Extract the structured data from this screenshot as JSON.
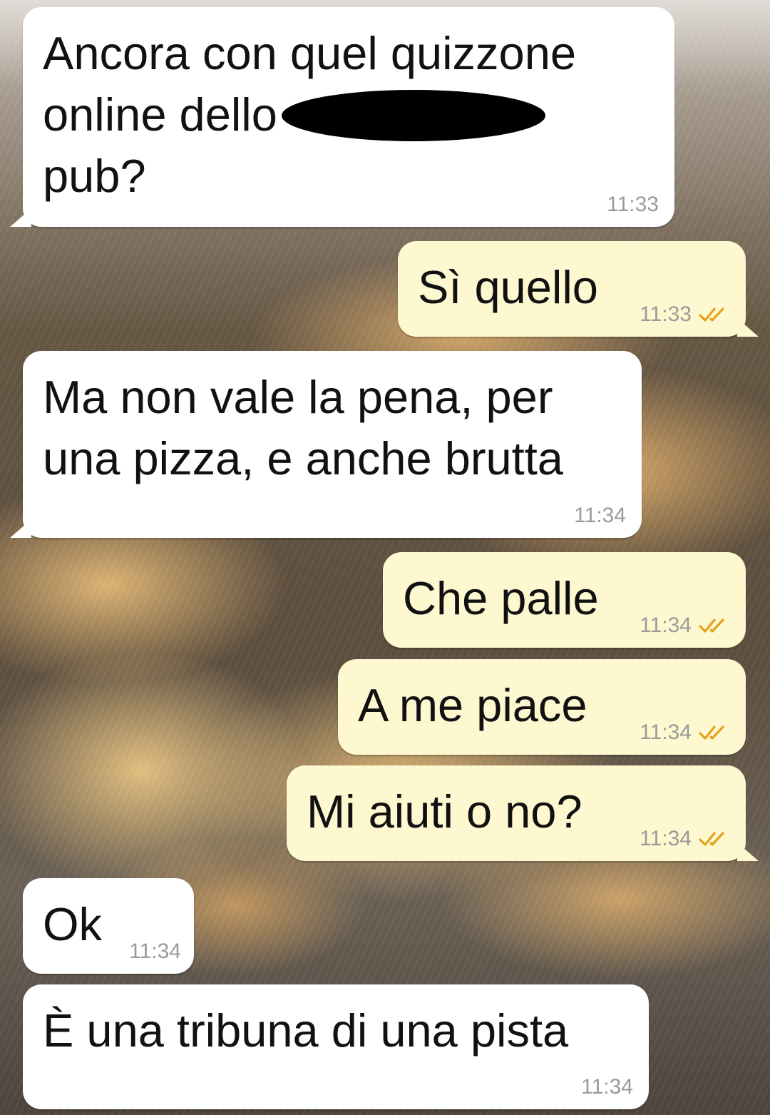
{
  "colors": {
    "incoming_bubble": "#ffffff",
    "outgoing_bubble": "#fdf8d0",
    "read_ticks": "#e3a21a",
    "timestamp": "#9a9a9a"
  },
  "messages": [
    {
      "direction": "in",
      "line1": "Ancora con quel quizzone",
      "line2": "online dello",
      "line3": "pub?",
      "time": "11:33",
      "redacted_icon": "redaction-mark"
    },
    {
      "direction": "out",
      "text": "Sì quello",
      "time": "11:33",
      "status_icon": "double-check-icon"
    },
    {
      "direction": "in",
      "text": "Ma non vale la pena, per\nuna pizza, e anche brutta",
      "time": "11:34"
    },
    {
      "direction": "out",
      "text": "Che palle",
      "time": "11:34",
      "status_icon": "double-check-icon"
    },
    {
      "direction": "out",
      "text": "A me piace",
      "time": "11:34",
      "status_icon": "double-check-icon"
    },
    {
      "direction": "out",
      "text": "Mi aiuti o no?",
      "time": "11:34",
      "status_icon": "double-check-icon"
    },
    {
      "direction": "in",
      "text": "Ok",
      "time": "11:34"
    },
    {
      "direction": "in",
      "text": "È una tribuna di una pista",
      "time": "11:34"
    }
  ]
}
